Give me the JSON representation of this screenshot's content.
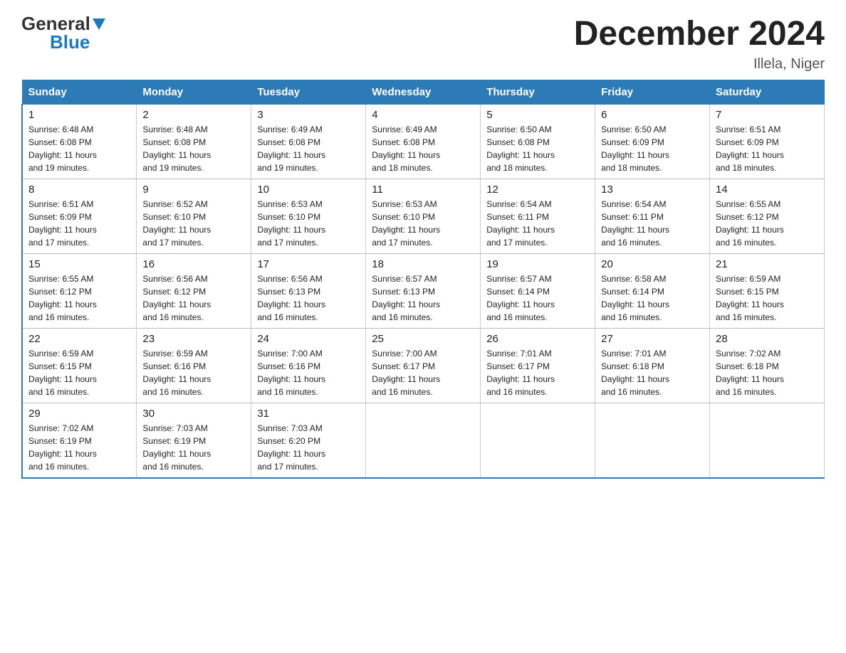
{
  "header": {
    "logo_general": "General",
    "logo_blue": "Blue",
    "title": "December 2024",
    "location": "Illela, Niger"
  },
  "days_of_week": [
    "Sunday",
    "Monday",
    "Tuesday",
    "Wednesday",
    "Thursday",
    "Friday",
    "Saturday"
  ],
  "weeks": [
    [
      {
        "day": "1",
        "sunrise": "6:48 AM",
        "sunset": "6:08 PM",
        "daylight": "11 hours and 19 minutes."
      },
      {
        "day": "2",
        "sunrise": "6:48 AM",
        "sunset": "6:08 PM",
        "daylight": "11 hours and 19 minutes."
      },
      {
        "day": "3",
        "sunrise": "6:49 AM",
        "sunset": "6:08 PM",
        "daylight": "11 hours and 19 minutes."
      },
      {
        "day": "4",
        "sunrise": "6:49 AM",
        "sunset": "6:08 PM",
        "daylight": "11 hours and 18 minutes."
      },
      {
        "day": "5",
        "sunrise": "6:50 AM",
        "sunset": "6:08 PM",
        "daylight": "11 hours and 18 minutes."
      },
      {
        "day": "6",
        "sunrise": "6:50 AM",
        "sunset": "6:09 PM",
        "daylight": "11 hours and 18 minutes."
      },
      {
        "day": "7",
        "sunrise": "6:51 AM",
        "sunset": "6:09 PM",
        "daylight": "11 hours and 18 minutes."
      }
    ],
    [
      {
        "day": "8",
        "sunrise": "6:51 AM",
        "sunset": "6:09 PM",
        "daylight": "11 hours and 17 minutes."
      },
      {
        "day": "9",
        "sunrise": "6:52 AM",
        "sunset": "6:10 PM",
        "daylight": "11 hours and 17 minutes."
      },
      {
        "day": "10",
        "sunrise": "6:53 AM",
        "sunset": "6:10 PM",
        "daylight": "11 hours and 17 minutes."
      },
      {
        "day": "11",
        "sunrise": "6:53 AM",
        "sunset": "6:10 PM",
        "daylight": "11 hours and 17 minutes."
      },
      {
        "day": "12",
        "sunrise": "6:54 AM",
        "sunset": "6:11 PM",
        "daylight": "11 hours and 17 minutes."
      },
      {
        "day": "13",
        "sunrise": "6:54 AM",
        "sunset": "6:11 PM",
        "daylight": "11 hours and 16 minutes."
      },
      {
        "day": "14",
        "sunrise": "6:55 AM",
        "sunset": "6:12 PM",
        "daylight": "11 hours and 16 minutes."
      }
    ],
    [
      {
        "day": "15",
        "sunrise": "6:55 AM",
        "sunset": "6:12 PM",
        "daylight": "11 hours and 16 minutes."
      },
      {
        "day": "16",
        "sunrise": "6:56 AM",
        "sunset": "6:12 PM",
        "daylight": "11 hours and 16 minutes."
      },
      {
        "day": "17",
        "sunrise": "6:56 AM",
        "sunset": "6:13 PM",
        "daylight": "11 hours and 16 minutes."
      },
      {
        "day": "18",
        "sunrise": "6:57 AM",
        "sunset": "6:13 PM",
        "daylight": "11 hours and 16 minutes."
      },
      {
        "day": "19",
        "sunrise": "6:57 AM",
        "sunset": "6:14 PM",
        "daylight": "11 hours and 16 minutes."
      },
      {
        "day": "20",
        "sunrise": "6:58 AM",
        "sunset": "6:14 PM",
        "daylight": "11 hours and 16 minutes."
      },
      {
        "day": "21",
        "sunrise": "6:59 AM",
        "sunset": "6:15 PM",
        "daylight": "11 hours and 16 minutes."
      }
    ],
    [
      {
        "day": "22",
        "sunrise": "6:59 AM",
        "sunset": "6:15 PM",
        "daylight": "11 hours and 16 minutes."
      },
      {
        "day": "23",
        "sunrise": "6:59 AM",
        "sunset": "6:16 PM",
        "daylight": "11 hours and 16 minutes."
      },
      {
        "day": "24",
        "sunrise": "7:00 AM",
        "sunset": "6:16 PM",
        "daylight": "11 hours and 16 minutes."
      },
      {
        "day": "25",
        "sunrise": "7:00 AM",
        "sunset": "6:17 PM",
        "daylight": "11 hours and 16 minutes."
      },
      {
        "day": "26",
        "sunrise": "7:01 AM",
        "sunset": "6:17 PM",
        "daylight": "11 hours and 16 minutes."
      },
      {
        "day": "27",
        "sunrise": "7:01 AM",
        "sunset": "6:18 PM",
        "daylight": "11 hours and 16 minutes."
      },
      {
        "day": "28",
        "sunrise": "7:02 AM",
        "sunset": "6:18 PM",
        "daylight": "11 hours and 16 minutes."
      }
    ],
    [
      {
        "day": "29",
        "sunrise": "7:02 AM",
        "sunset": "6:19 PM",
        "daylight": "11 hours and 16 minutes."
      },
      {
        "day": "30",
        "sunrise": "7:03 AM",
        "sunset": "6:19 PM",
        "daylight": "11 hours and 16 minutes."
      },
      {
        "day": "31",
        "sunrise": "7:03 AM",
        "sunset": "6:20 PM",
        "daylight": "11 hours and 17 minutes."
      },
      null,
      null,
      null,
      null
    ]
  ],
  "labels": {
    "sunrise": "Sunrise:",
    "sunset": "Sunset:",
    "daylight": "Daylight:"
  }
}
